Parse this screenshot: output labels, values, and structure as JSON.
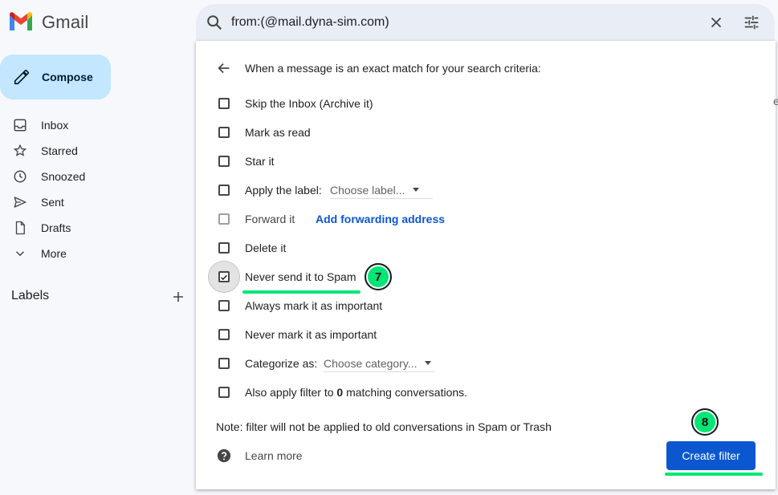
{
  "app": {
    "name": "Gmail"
  },
  "colors": {
    "compose_bg": "#c2e7ff",
    "accent_blue": "#0b57d0",
    "annotation_green": "#00e676",
    "search_bg": "#e9eef6"
  },
  "compose": {
    "label": "Compose",
    "icon": "pencil-icon"
  },
  "sidebar": {
    "items": [
      {
        "label": "Inbox",
        "icon": "inbox-icon"
      },
      {
        "label": "Starred",
        "icon": "star-icon"
      },
      {
        "label": "Snoozed",
        "icon": "clock-icon"
      },
      {
        "label": "Sent",
        "icon": "send-icon"
      },
      {
        "label": "Drafts",
        "icon": "draft-icon"
      },
      {
        "label": "More",
        "icon": "chevron-down-icon"
      }
    ],
    "labels_title": "Labels"
  },
  "search": {
    "value": "from:(@mail.dyna-sim.com)"
  },
  "filter": {
    "header": "When a message is an exact match for your search criteria:",
    "options": [
      {
        "label": "Skip the Inbox (Archive it)",
        "checked": false
      },
      {
        "label": "Mark as read",
        "checked": false
      },
      {
        "label": "Star it",
        "checked": false
      },
      {
        "label": "Apply the label:",
        "checked": false,
        "select": "Choose label..."
      },
      {
        "label": "Forward it",
        "checked": false,
        "disabled": true,
        "link": "Add forwarding address"
      },
      {
        "label": "Delete it",
        "checked": false
      },
      {
        "label": "Never send it to Spam",
        "checked": true
      },
      {
        "label": "Always mark it as important",
        "checked": false
      },
      {
        "label": "Never mark it as important",
        "checked": false
      },
      {
        "label": "Categorize as:",
        "checked": false,
        "select": "Choose category..."
      },
      {
        "label_prefix": "Also apply filter to",
        "count": "0",
        "label_suffix": "matching conversations.",
        "checked": false
      }
    ],
    "note": "Note: filter will not be applied to old conversations in Spam or Trash",
    "learn_more": "Learn more",
    "create_button": "Create filter"
  },
  "annotations": [
    {
      "step": "7",
      "target": "Never send it to Spam"
    },
    {
      "step": "8",
      "target": "Create filter"
    }
  ],
  "clipped_text": "e"
}
